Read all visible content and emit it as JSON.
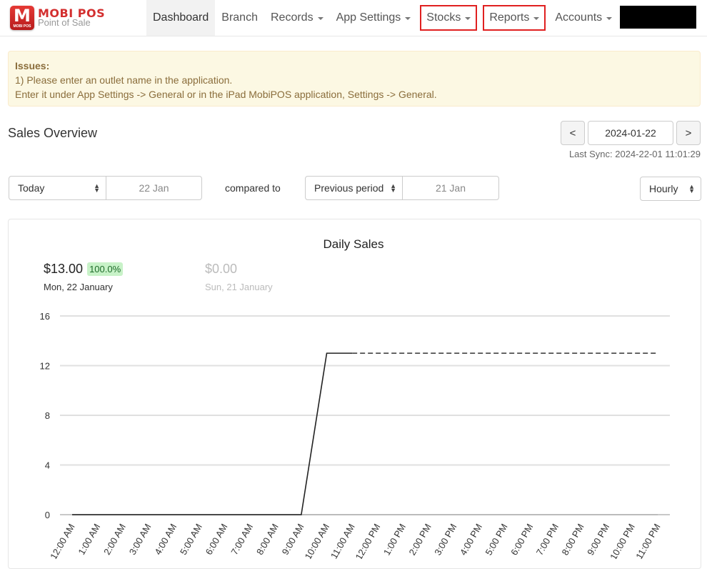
{
  "brand": {
    "name": "MOBI POS",
    "tagline": "Point of Sale",
    "logo_letter": "M",
    "logo_sub": "MOBI POS"
  },
  "nav": {
    "items": [
      {
        "label": "Dashboard",
        "active": true,
        "dropdown": false,
        "highlighted": false
      },
      {
        "label": "Branch",
        "active": false,
        "dropdown": false,
        "highlighted": false
      },
      {
        "label": "Records",
        "active": false,
        "dropdown": true,
        "highlighted": false
      },
      {
        "label": "App Settings",
        "active": false,
        "dropdown": true,
        "highlighted": false
      },
      {
        "label": "Stocks",
        "active": false,
        "dropdown": true,
        "highlighted": true
      },
      {
        "label": "Reports",
        "active": false,
        "dropdown": true,
        "highlighted": true
      },
      {
        "label": "Accounts",
        "active": false,
        "dropdown": true,
        "highlighted": false
      }
    ],
    "highlight_color": "#e02020"
  },
  "alert": {
    "title": "Issues:",
    "line1": "1) Please enter an outlet name in the application.",
    "line2": "Enter it under App Settings -> General or in the iPad MobiPOS application, Settings -> General."
  },
  "overview": {
    "title": "Sales Overview",
    "prev_label": "<",
    "next_label": ">",
    "date": "2024-01-22",
    "last_sync": "Last Sync: 2024-22-01 11:01:29"
  },
  "filters": {
    "period": "Today",
    "period_date": "22 Jan",
    "compared_to_label": "compared to",
    "compare": "Previous period",
    "compare_date": "21 Jan",
    "interval": "Hourly"
  },
  "summary": {
    "current": {
      "amount": "$13.00",
      "change": "100.0%",
      "day": "Mon, 22 January"
    },
    "previous": {
      "amount": "$0.00",
      "day": "Sun, 21 January"
    }
  },
  "chart_data": {
    "type": "line",
    "title": "Daily Sales",
    "xlabel": "",
    "ylabel": "",
    "ylim": [
      0,
      16
    ],
    "yticks": [
      0,
      4,
      8,
      12,
      16
    ],
    "grid": true,
    "categories": [
      "12:00 AM",
      "1:00 AM",
      "2:00 AM",
      "3:00 AM",
      "4:00 AM",
      "5:00 AM",
      "6:00 AM",
      "7:00 AM",
      "8:00 AM",
      "9:00 AM",
      "10:00 AM",
      "11:00 AM",
      "12:00 PM",
      "1:00 PM",
      "2:00 PM",
      "3:00 PM",
      "4:00 PM",
      "5:00 PM",
      "6:00 PM",
      "7:00 PM",
      "8:00 PM",
      "9:00 PM",
      "10:00 PM",
      "11:00 PM"
    ],
    "series": [
      {
        "name": "Mon, 22 January",
        "style": "solid",
        "color": "#222222",
        "values": [
          0,
          0,
          0,
          0,
          0,
          0,
          0,
          0,
          0,
          0,
          13,
          13,
          null,
          null,
          null,
          null,
          null,
          null,
          null,
          null,
          null,
          null,
          null,
          null
        ]
      },
      {
        "name": "Mon, 22 January (projected)",
        "style": "dashed",
        "color": "#333333",
        "values": [
          null,
          null,
          null,
          null,
          null,
          null,
          null,
          null,
          null,
          null,
          null,
          13,
          13,
          13,
          13,
          13,
          13,
          13,
          13,
          13,
          13,
          13,
          13,
          13
        ]
      },
      {
        "name": "Sun, 21 January",
        "style": "solid",
        "color": "#bbbbbb",
        "values": [
          0,
          0,
          0,
          0,
          0,
          0,
          0,
          0,
          0,
          0,
          0,
          0,
          0,
          0,
          0,
          0,
          0,
          0,
          0,
          0,
          0,
          0,
          0,
          0
        ]
      }
    ]
  }
}
